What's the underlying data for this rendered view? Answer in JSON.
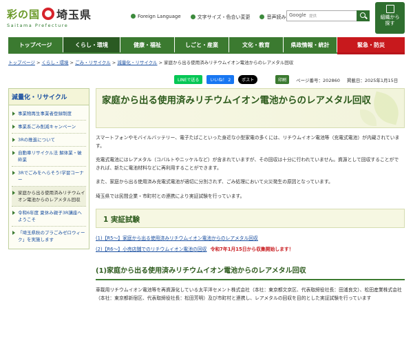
{
  "header": {
    "logo_left": "彩の国",
    "logo_right": "埼玉県",
    "logo_sub": "Saitama Prefecture",
    "utility": [
      "Foreign Language",
      "文字サイズ・色合い変更",
      "音声読み上げ"
    ],
    "search_engine": "Google",
    "search_placeholder": "提供",
    "org_button": [
      "組織から",
      "探す"
    ]
  },
  "nav": {
    "items": [
      "トップページ",
      "くらし・環境",
      "健康・福祉",
      "しごと・産業",
      "文化・教育",
      "県政情報・統計",
      "緊急・防災"
    ],
    "active_index": 1
  },
  "breadcrumb": [
    "トップページ",
    "くらし・環境",
    "ごみ・リサイクル",
    "減量化・リサイクル",
    "家庭から出る使用済みリチウムイオン電池からのレアメタル回収"
  ],
  "share": {
    "line": "LINEで送る",
    "facebook": "いいね！ 2",
    "x": "ポスト",
    "print": "印刷",
    "page_number": "ページ番号：202860",
    "published": "掲載日：2025年1月15日"
  },
  "sidebar": {
    "title": "減量化・リサイクル",
    "items": [
      "事業物再生事業者登録制度",
      "事業系ごみ削減キャンペーン",
      "3Rの推進について",
      "自動車リサイクル法 解体業・破砕業",
      "3Rでごみをへらそう!学習コーナー",
      "家庭から出る使用済みリチウムイオン電池からのレアメタル回収",
      "令和6年度 夏休み親子3R講座へようこそ",
      "「埼玉県秋のプラごみゼロウィーク」を実施します"
    ],
    "current_index": 5
  },
  "main": {
    "title": "家庭から出る使用済みリチウムイオン電池からのレアメタル回収",
    "paragraphs": [
      "スマートフォンやモバイルバッテリー、電子たばこといった身近な小型家電の多くには、リチウムイオン電池等（充電式電池）が内蔵されています。",
      "充電式電池にはレアメタル（コバルトやニッケルなど）が含まれていますが、その回収は十分に行われていません。資源として回収することができれば、新たに電池材料などに再利用することができます。",
      "また、家庭から出る使用済み充電式電池が適切に分別されず、ごみ処理において火災発生の原因となっています。",
      "埼玉県では民間企業・市町村との連携により実証試験を行っています。"
    ],
    "h2": "1 実証試験",
    "links": [
      {
        "text": "(1)【R5～】家庭から出る使用済みリチウムイオン電池からのレアメタル回収",
        "alert": ""
      },
      {
        "text": "(2)【R6～】小売店舗でのリチウムイオン電池の回収",
        "alert": "令和7年1月15日から収集開始します！"
      }
    ],
    "h3": "(1)家庭から出る使用済みリチウムイオン電池からのレアメタル回収",
    "body": "車載用リチウムイオン電池等を再資源化している太平洋セメント株式会社（本社：東京都文京区、代表取締役社長：田浦良文）、松田産業株式会社（本社：東京都新宿区、代表取締役社長：松田芳明）及び市町村と連携し、レアメタルの回収を目的とした実証試験を行っています"
  },
  "colors": {
    "brand_green": "#3b7a30",
    "emergency_red": "#c8191d",
    "link_blue": "#1a4fa0"
  }
}
